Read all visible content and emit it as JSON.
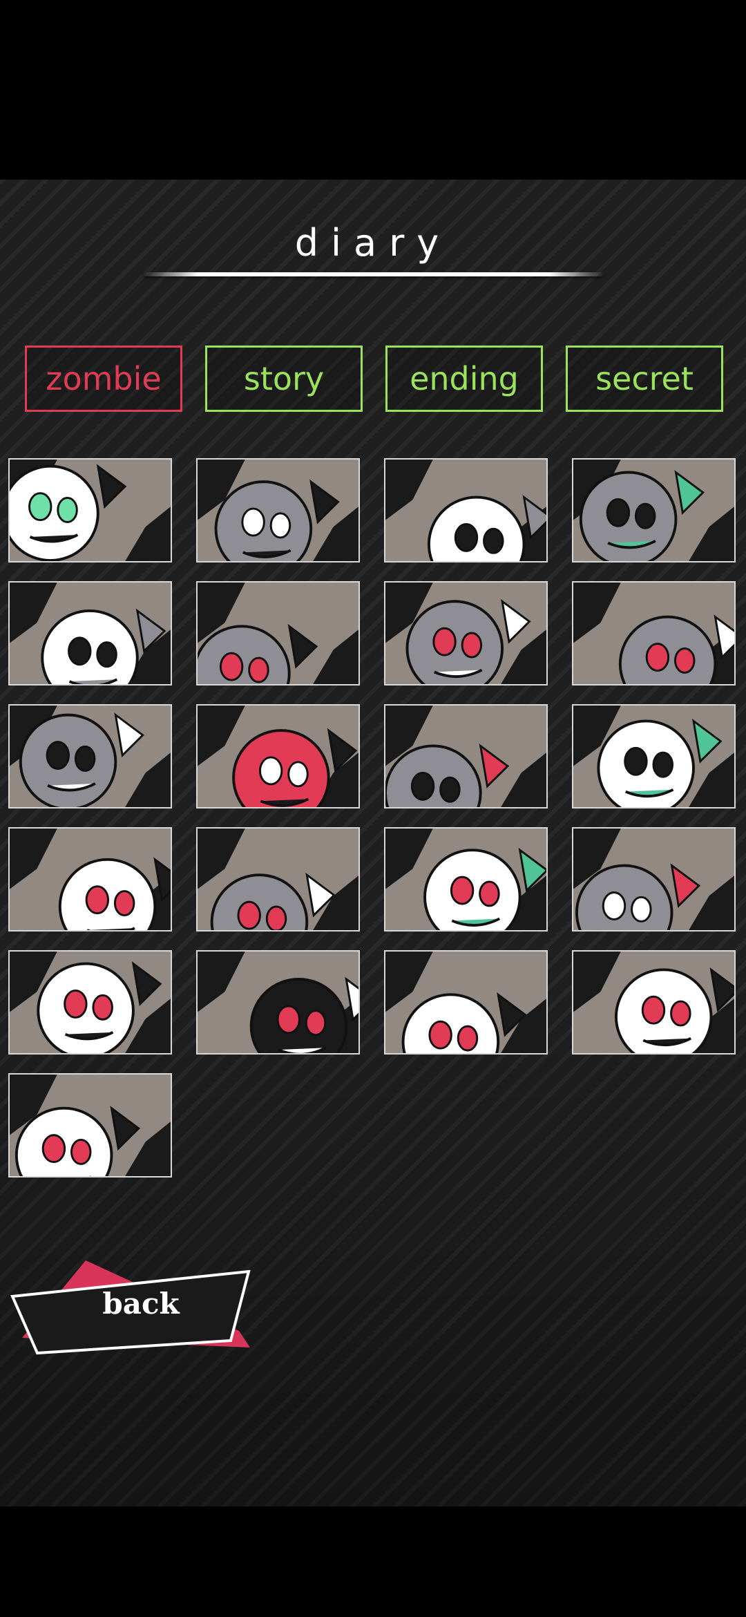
{
  "screen": {
    "title": "diary"
  },
  "tabs": [
    {
      "label": "zombie",
      "active": true
    },
    {
      "label": "story",
      "active": false
    },
    {
      "label": "ending",
      "active": false
    },
    {
      "label": "secret",
      "active": false
    }
  ],
  "diary_entries": [
    {
      "icon": "white-rabbit-zombie-thumbnail"
    },
    {
      "icon": "sleeping-gray-zombie-thumbnail"
    },
    {
      "icon": "grinning-teeth-zombie-thumbnail"
    },
    {
      "icon": "chained-creature-thumbnail"
    },
    {
      "icon": "skull-face-zombie-thumbnail"
    },
    {
      "icon": "long-hair-zombie-thumbnail"
    },
    {
      "icon": "crying-zombie-thumbnail"
    },
    {
      "icon": "many-eyes-blob-thumbnail"
    },
    {
      "icon": "spiky-balloon-zombie-thumbnail"
    },
    {
      "icon": "hooded-button-eyes-zombie-thumbnail"
    },
    {
      "icon": "heart-shirt-zombie-thumbnail"
    },
    {
      "icon": "grinning-mask-zombie-thumbnail"
    },
    {
      "icon": "white-hair-zombie-thumbnail"
    },
    {
      "icon": "gray-hair-zombie-thumbnail"
    },
    {
      "icon": "stitched-face-zombie-thumbnail"
    },
    {
      "icon": "ghost-companion-zombie-thumbnail"
    },
    {
      "icon": "one-eye-stitched-zombie-thumbnail"
    },
    {
      "icon": "masked-black-hair-zombie-thumbnail"
    },
    {
      "icon": "winged-white-hair-zombie-thumbnail"
    },
    {
      "icon": "twin-zombies-thumbnail"
    },
    {
      "icon": "silver-hair-zombie-thumbnail"
    }
  ],
  "back_button": {
    "label": "back"
  },
  "colors": {
    "active_tab": "#e23b56",
    "inactive_tab": "#9be35a",
    "background": "#1f1f1f",
    "thumb_bg": "#928a82"
  }
}
